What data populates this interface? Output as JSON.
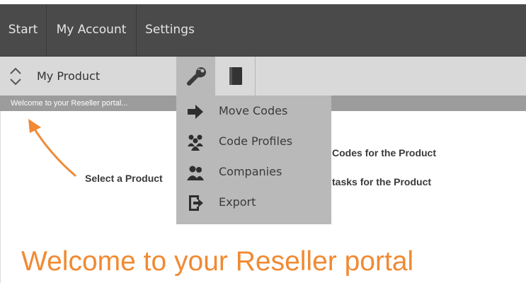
{
  "nav": {
    "items": [
      {
        "label": "Start"
      },
      {
        "label": "My Account"
      },
      {
        "label": "Settings"
      }
    ]
  },
  "toolbar": {
    "product_label": "My Product",
    "tools": [
      {
        "icon": "wrench-icon"
      },
      {
        "icon": "book-icon"
      }
    ]
  },
  "status": {
    "text": "Welcome to your Reseller portal..."
  },
  "menu": {
    "items": [
      {
        "label": "Move Codes",
        "icon": "arrow-right-icon"
      },
      {
        "label": "Code Profiles",
        "icon": "users-group-icon"
      },
      {
        "label": "Companies",
        "icon": "company-people-icon"
      },
      {
        "label": "Export",
        "icon": "export-icon"
      }
    ]
  },
  "hints": {
    "select_product": "Select a Product",
    "codes_for_product": "Codes for the Product",
    "tasks_for_product": "tasks for the Product"
  },
  "main": {
    "heading": "Welcome to your Reseller portal"
  },
  "colors": {
    "navbar": "#4a4a4a",
    "toolbar": "#d9d9d9",
    "menu": "#b9b9b9",
    "status_bar": "#9c9c9c",
    "accent": "#f08a33"
  }
}
